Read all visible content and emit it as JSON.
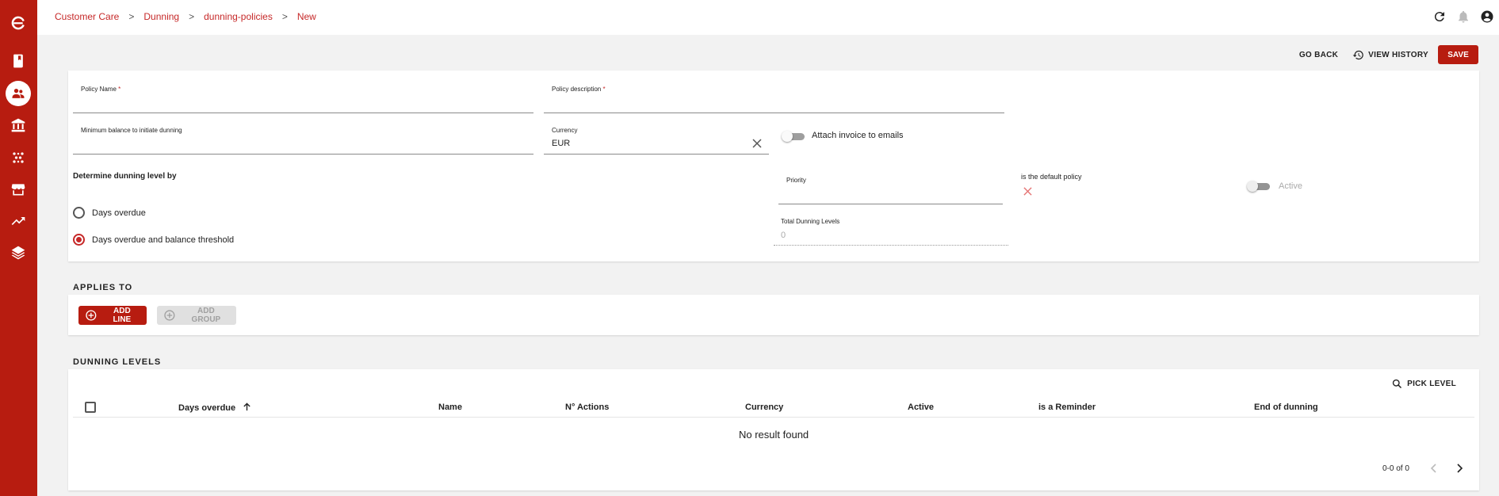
{
  "sidebar": {
    "items": [
      {
        "icon": "logo-icon"
      },
      {
        "icon": "book-icon"
      },
      {
        "icon": "people-icon",
        "active": true
      },
      {
        "icon": "bank-icon"
      },
      {
        "icon": "grid-dots-icon"
      },
      {
        "icon": "store-icon"
      },
      {
        "icon": "trending-icon"
      },
      {
        "icon": "layers-icon"
      }
    ]
  },
  "breadcrumb": [
    "Customer Care",
    "Dunning",
    "dunning-policies",
    "New"
  ],
  "actions": {
    "go_back": "GO BACK",
    "view_history": "VIEW HISTORY",
    "save": "SAVE"
  },
  "form": {
    "policy_name_label": "Policy Name",
    "policy_description_label": "Policy description",
    "required_mark": "*",
    "min_balance_label": "Minimum balance to initiate dunning",
    "currency_label": "Currency",
    "currency_value": "EUR",
    "attach_invoice_label": "Attach invoice to emails",
    "determine_label": "Determine dunning level by",
    "radio_days_overdue": "Days overdue",
    "radio_days_balance": "Days overdue and balance threshold",
    "priority_label": "Priority",
    "default_policy_label": "is the default policy",
    "active_label": "Active",
    "total_levels_label": "Total Dunning Levels",
    "total_levels_value": "0"
  },
  "applies_to": {
    "title": "APPLIES TO",
    "add_line": "ADD LINE",
    "add_group": "ADD GROUP"
  },
  "dunning_levels": {
    "title": "DUNNING LEVELS",
    "pick_level": "PICK LEVEL",
    "columns": [
      "Days overdue",
      "Name",
      "N° Actions",
      "Currency",
      "Active",
      "is a Reminder",
      "End of dunning"
    ],
    "empty": "No result found",
    "pagination": "0-0 of 0"
  },
  "colors": {
    "brand": "#b71c10",
    "accent_text": "#c62828"
  }
}
